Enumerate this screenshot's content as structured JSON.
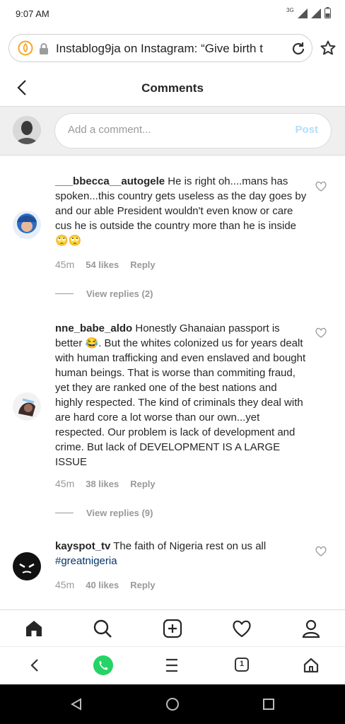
{
  "status": {
    "time": "9:07 AM",
    "network": "3G"
  },
  "browser": {
    "url_text": "Instablog9ja on Instagram: “Give birth t"
  },
  "header": {
    "title": "Comments"
  },
  "composer": {
    "placeholder": "Add a comment...",
    "post_label": "Post"
  },
  "comments": [
    {
      "username": "___bbecca__autogele",
      "text": " He is right oh....mans has spoken...this country gets useless as the day goes by and our able President wouldn't even know or care cus he is outside the country more than he is inside🙄🙄",
      "time": "45m",
      "likes": "54 likes",
      "reply": "Reply",
      "view_replies": "View replies (2)"
    },
    {
      "username": "nne_babe_aldo",
      "text": " Honestly Ghanaian passport is better 😂. But the whites colonized us for years dealt with human trafficking and even enslaved and bought human beings. That is worse than commiting fraud, yet they are ranked one of the best nations and highly respected. The kind of criminals they deal with are hard core a lot worse than our own...yet respected. Our problem is lack of development and crime. But lack of DEVELOPMENT IS A LARGE ISSUE",
      "time": "45m",
      "likes": "38 likes",
      "reply": "Reply",
      "view_replies": "View replies (9)"
    },
    {
      "username": "kayspot_tv",
      "text": " The faith of Nigeria rest on us all ",
      "hashtag": "#greatnigeria",
      "time": "45m",
      "likes": "40 likes",
      "reply": "Reply"
    }
  ],
  "browser_tabs_count": "1",
  "colors": {
    "link": "#003569",
    "muted": "#999999",
    "post_disabled": "#b2dffc",
    "whatsapp": "#25d366"
  },
  "icons": [
    "back-arrow-icon",
    "home-icon",
    "search-icon",
    "new-post-icon",
    "heart-icon",
    "profile-icon",
    "whatsapp-icon",
    "menu-icon",
    "tabs-icon",
    "browser-home-icon",
    "reload-icon",
    "star-icon",
    "lock-icon"
  ]
}
